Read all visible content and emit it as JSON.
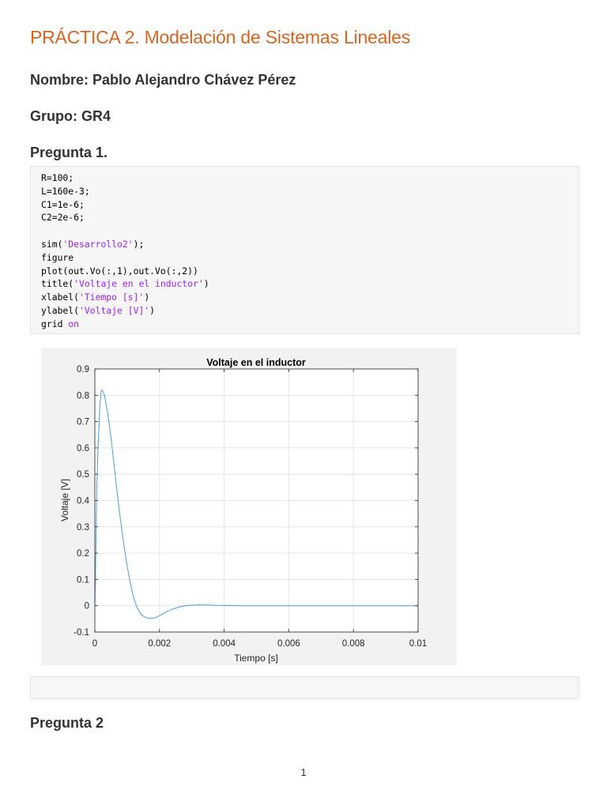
{
  "doc": {
    "title": "PRÁCTICA 2. Modelación de Sistemas Lineales",
    "name_line": "Nombre: Pablo Alejandro Chávez Pérez",
    "group_line": "Grupo: GR4",
    "q1_heading": "Pregunta 1.",
    "q2_heading": "Pregunta 2",
    "page_number": "1"
  },
  "code": {
    "lines": [
      [
        {
          "t": "R=100;"
        }
      ],
      [
        {
          "t": "L=160e-3;"
        }
      ],
      [
        {
          "t": "C1=1e-6;"
        }
      ],
      [
        {
          "t": "C2=2e-6;"
        }
      ],
      [
        {
          "t": ""
        }
      ],
      [
        {
          "t": "sim("
        },
        {
          "t": "'Desarrollo2'",
          "c": "str"
        },
        {
          "t": ");"
        }
      ],
      [
        {
          "t": "figure"
        }
      ],
      [
        {
          "t": "plot(out.Vo(:,1),out.Vo(:,2))"
        }
      ],
      [
        {
          "t": "title("
        },
        {
          "t": "'Voltaje en el inductor'",
          "c": "str"
        },
        {
          "t": ")"
        }
      ],
      [
        {
          "t": "xlabel("
        },
        {
          "t": "'Tiempo [s]'",
          "c": "str"
        },
        {
          "t": ")"
        }
      ],
      [
        {
          "t": "ylabel("
        },
        {
          "t": "'Voltaje [V]'",
          "c": "str"
        },
        {
          "t": ")"
        }
      ],
      [
        {
          "t": "grid "
        },
        {
          "t": "on",
          "c": "kw"
        }
      ]
    ]
  },
  "chart_data": {
    "type": "line",
    "title": "Voltaje en el inductor",
    "xlabel": "Tiempo [s]",
    "ylabel": "Voltaje [V]",
    "xlim": [
      0,
      0.01
    ],
    "ylim": [
      -0.1,
      0.9
    ],
    "grid": true,
    "line_color": "#4a9fd8",
    "xticks": [
      0,
      0.002,
      0.004,
      0.006,
      0.008,
      0.01
    ],
    "xtick_labels": [
      "0",
      "0.002",
      "0.004",
      "0.006",
      "0.008",
      "0.01"
    ],
    "yticks": [
      -0.1,
      0,
      0.1,
      0.2,
      0.3,
      0.4,
      0.5,
      0.6,
      0.7,
      0.8,
      0.9
    ],
    "ytick_labels": [
      "-0.1",
      "0",
      "0.1",
      "0.2",
      "0.3",
      "0.4",
      "0.5",
      "0.6",
      "0.7",
      "0.8",
      "0.9"
    ],
    "series": [
      {
        "x": [
          0,
          3e-05,
          6e-05,
          0.0001,
          0.00015,
          0.0002,
          0.00025,
          0.0003,
          0.0004,
          0.0005,
          0.0006,
          0.0007,
          0.0008,
          0.0009,
          0.001,
          0.0011,
          0.0012,
          0.0013,
          0.0014,
          0.0015,
          0.0016,
          0.0017,
          0.0018,
          0.0019,
          0.002,
          0.0021,
          0.0022,
          0.0024,
          0.0026,
          0.0028,
          0.003,
          0.0032,
          0.0034,
          0.0036,
          0.0038,
          0.004,
          0.0042,
          0.0045,
          0.005,
          0.006,
          0.007,
          0.008,
          0.009,
          0.01
        ],
        "y": [
          0,
          0.2,
          0.45,
          0.6,
          0.75,
          0.82,
          0.815,
          0.8,
          0.73,
          0.64,
          0.53,
          0.42,
          0.32,
          0.23,
          0.15,
          0.085,
          0.03,
          -0.005,
          -0.028,
          -0.04,
          -0.046,
          -0.048,
          -0.047,
          -0.044,
          -0.038,
          -0.031,
          -0.024,
          -0.013,
          -0.005,
          0.0,
          0.002,
          0.003,
          0.003,
          0.002,
          0.0015,
          0.001,
          0.0005,
          0.0,
          0.0,
          0.0,
          0.0,
          0.0,
          0.0,
          0.0
        ]
      }
    ]
  }
}
